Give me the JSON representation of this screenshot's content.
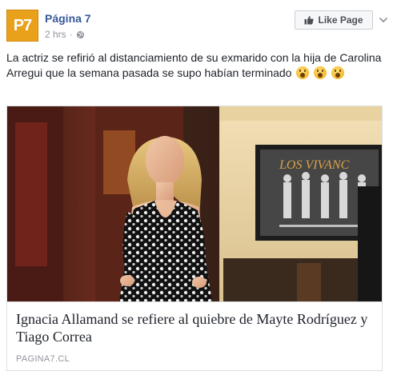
{
  "page": {
    "name": "Página 7",
    "avatar_text": "P7",
    "timestamp": "2 hrs",
    "separator": "·",
    "privacy_icon": "globe-icon"
  },
  "actions": {
    "like_page_label": "Like Page",
    "like_icon": "thumbs-up-icon",
    "menu_icon": "chevron-down-icon"
  },
  "post": {
    "text": "La actriz se refirió al distanciamiento de su exmaridо con la hija de Carolina Arregui que la semana pasada se supo habían terminado",
    "emoji_icon": "wow-emoji-icon"
  },
  "link_card": {
    "title": "Ignacia Allamand se refiere al quiebre de Mayte Rodríguez y Tiago Correa",
    "domain": "PAGINA7.CL",
    "poster_text": "LOS VIVANC"
  },
  "colors": {
    "link_blue": "#365899",
    "meta_gray": "#90949c",
    "avatar_orange": "#e9a11c"
  }
}
